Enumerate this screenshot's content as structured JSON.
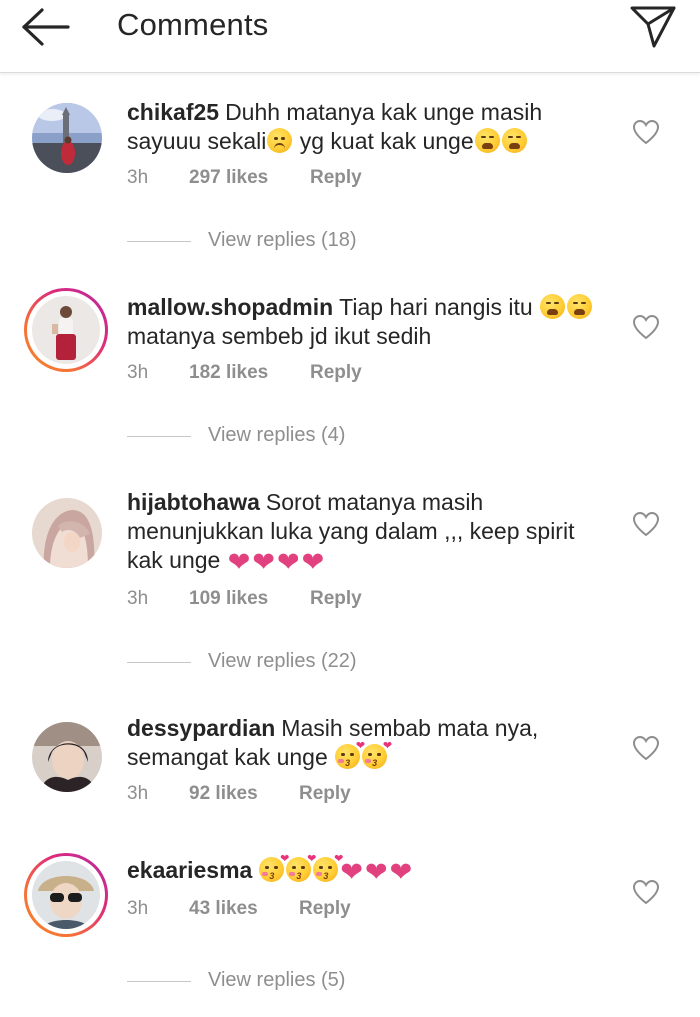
{
  "header": {
    "title": "Comments",
    "back_icon": "arrow-left-icon",
    "send_icon": "paper-plane-icon"
  },
  "comments": [
    {
      "username": "chikaf25",
      "text_a": "Duhh matanya kak unge masih sayuuu sekali",
      "emoji_a": "frowning-face-emoji",
      "text_b": " yg kuat kak unge",
      "emoji_b": "tired-face-emoji",
      "time": "3h",
      "likes": "297 likes",
      "reply": "Reply",
      "view_replies": "View replies (18)",
      "avatar_ring": false
    },
    {
      "username": "mallow.shopadmin",
      "text_a": "Tiap hari nangis itu ",
      "emoji_a": "tired-face-emoji",
      "text_b": "matanya sembeb jd ikut sedih",
      "time": "3h",
      "likes": "182 likes",
      "reply": "Reply",
      "view_replies": "View replies (4)",
      "avatar_ring": true
    },
    {
      "username": "hijabtohawa",
      "text_a": "Sorot matanya masih menunjukkan luka yang dalam ,,, keep spirit kak unge ",
      "emoji_a": "pink-heart-emoji",
      "time": "3h",
      "likes": "109 likes",
      "reply": "Reply",
      "view_replies": "View replies (22)",
      "avatar_ring": false
    },
    {
      "username": "dessypardian",
      "text_a": "Masih sembab mata nya, semangat kak unge ",
      "emoji_a": "kissing-face-emoji",
      "time": "3h",
      "likes": "92 likes",
      "reply": "Reply",
      "avatar_ring": false
    },
    {
      "username": "ekaariesma",
      "emoji_a": "kissing-face-emoji",
      "emoji_b": "pink-heart-emoji",
      "time": "3h",
      "likes": "43 likes",
      "reply": "Reply",
      "view_replies": "View replies (5)",
      "avatar_ring": true
    }
  ],
  "icons": {
    "like": "heart-outline-icon"
  },
  "colors": {
    "text": "#262626",
    "secondary": "#8e8e8e",
    "heart_emoji": "#e2417f",
    "story_ring": [
      "#f58529",
      "#dd2a7b",
      "#b32ba4"
    ]
  }
}
